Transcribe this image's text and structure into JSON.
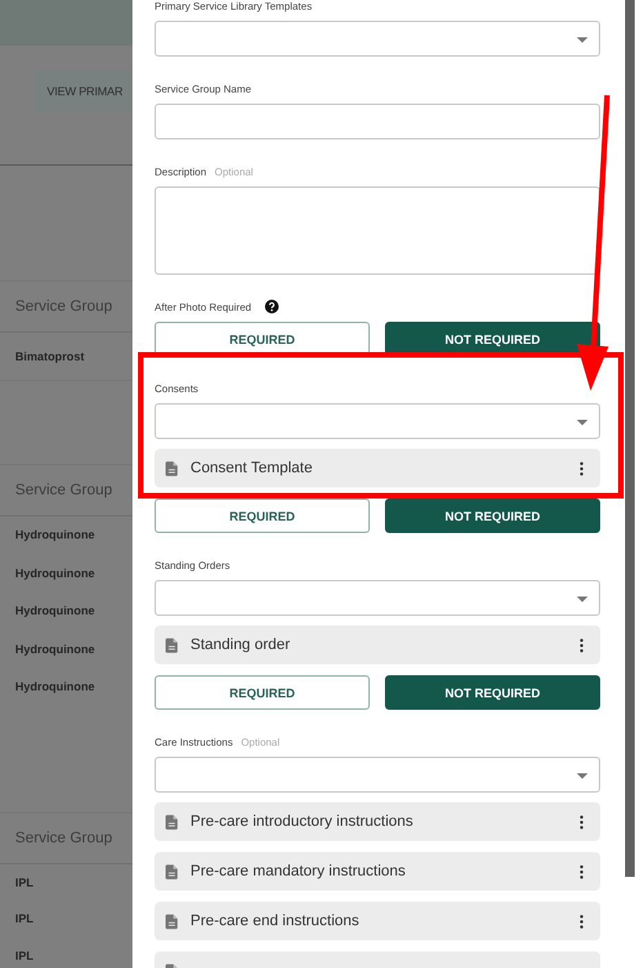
{
  "background": {
    "button": "VIEW PRIMAR",
    "groups": [
      {
        "header": "Service Group",
        "rows": [
          "Bimatoprost"
        ]
      },
      {
        "header": "Service Group",
        "rows": [
          "Hydroquinone",
          "Hydroquinone",
          "Hydroquinone",
          "Hydroquinone",
          "Hydroquinone"
        ]
      },
      {
        "header": "Service Group",
        "rows": [
          "IPL",
          "IPL",
          "IPL"
        ]
      }
    ]
  },
  "drawer": {
    "sections": [
      {
        "kind": "select",
        "label": "Primary Service Library Templates"
      },
      {
        "kind": "input",
        "label": "Service Group Name"
      },
      {
        "kind": "textarea",
        "label": "Description",
        "hint": "Optional"
      },
      {
        "kind": "toggle",
        "label": "After Photo Required",
        "help": true,
        "options": [
          {
            "label": "REQUIRED",
            "selected": false
          },
          {
            "label": "NOT REQUIRED",
            "selected": true
          }
        ]
      },
      {
        "kind": "select",
        "label": "Consents",
        "highlighted": true,
        "items": [
          "Consent Template"
        ]
      },
      {
        "kind": "toggle",
        "options": [
          {
            "label": "REQUIRED",
            "selected": false
          },
          {
            "label": "NOT REQUIRED",
            "selected": true
          }
        ]
      },
      {
        "kind": "select",
        "label": "Standing Orders",
        "items": [
          "Standing order"
        ]
      },
      {
        "kind": "toggle",
        "options": [
          {
            "label": "REQUIRED",
            "selected": false
          },
          {
            "label": "NOT REQUIRED",
            "selected": true
          }
        ]
      },
      {
        "kind": "select",
        "label": "Care Instructions",
        "hint": "Optional",
        "items": [
          "Pre-care introductory instructions",
          "Pre-care mandatory instructions",
          "Pre-care end instructions"
        ],
        "more_below": true
      }
    ]
  }
}
